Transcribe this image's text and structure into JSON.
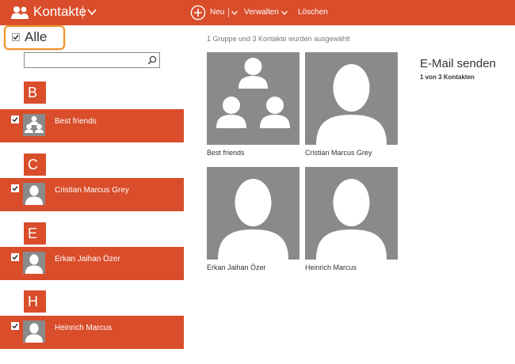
{
  "app": {
    "title": "Kontakte",
    "accent_color": "#d94d2a",
    "icon": "people-icon"
  },
  "commands": {
    "new_icon": "plus-circle-icon",
    "new_label": "Neu",
    "manage_label": "Verwalten",
    "delete_label": "Löschen"
  },
  "left_pane": {
    "select_all_label": "Alle",
    "select_all_checked": true,
    "search": {
      "value": "",
      "placeholder": "",
      "icon": "search-icon"
    },
    "groups": [
      {
        "letter": "B",
        "items": [
          {
            "name": "Best friends",
            "checked": true,
            "avatar": "group-icon"
          }
        ]
      },
      {
        "letter": "C",
        "items": [
          {
            "name": "Cristian Marcus Grey",
            "checked": true,
            "avatar": "person-icon"
          }
        ]
      },
      {
        "letter": "E",
        "items": [
          {
            "name": "Erkan Jaihan Özer",
            "checked": true,
            "avatar": "person-icon"
          }
        ]
      },
      {
        "letter": "H",
        "items": [
          {
            "name": "Heinrich Marcus",
            "checked": true,
            "avatar": "person-icon"
          }
        ]
      }
    ]
  },
  "main": {
    "status_text": "1 Gruppe und 3 Kontakte wurden ausgewählt",
    "tiles": [
      {
        "label": "Best friends",
        "avatar": "group-icon"
      },
      {
        "label": "Cristian Marcus Grey",
        "avatar": "person-icon"
      },
      {
        "label": "Erkan Jaihan Özer",
        "avatar": "person-icon"
      },
      {
        "label": "Heinrich Marcus",
        "avatar": "person-icon"
      }
    ]
  },
  "side_panel": {
    "title": "E-Mail senden",
    "subtitle": "1 von 3 Kontakten"
  }
}
